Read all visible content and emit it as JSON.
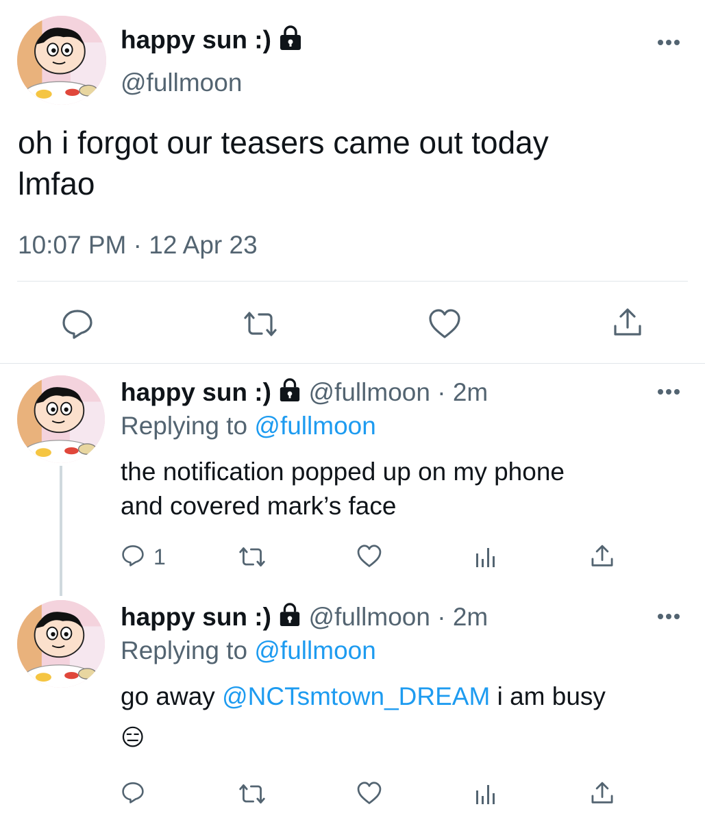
{
  "main_tweet": {
    "display_name": "happy sun :)",
    "handle": "@fullmoon",
    "text_line1": "oh i forgot our teasers came out today",
    "text_line2": "lmfao",
    "time": "10:07 PM",
    "separator": "·",
    "date": "12 Apr 23"
  },
  "replies": [
    {
      "display_name": "happy sun :)",
      "handle": "@fullmoon",
      "dot": "·",
      "age": "2m",
      "replying_prefix": "Replying to",
      "replying_handle": "@fullmoon",
      "text_line1": "the notification popped up on my phone",
      "text_line2": "and covered mark’s face",
      "reply_count": "1"
    },
    {
      "display_name": "happy sun :)",
      "handle": "@fullmoon",
      "dot": "·",
      "age": "2m",
      "replying_prefix": "Replying to",
      "replying_handle": "@fullmoon",
      "text_before": "go away",
      "mention": "@NCTsmtown_DREAM",
      "text_after": "i am busy",
      "emoji": "😑"
    }
  ],
  "colors": {
    "text": "#0f1419",
    "secondary": "#536471",
    "link": "#1d9bf0",
    "divider": "#e1e6ea"
  }
}
